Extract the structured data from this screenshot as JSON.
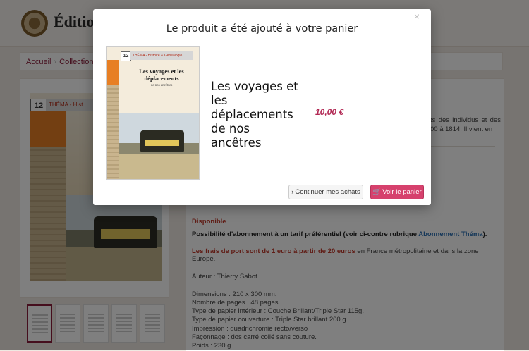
{
  "header": {
    "brand": "Éditions"
  },
  "breadcrumb": {
    "home": "Accueil",
    "collection": "Collection Thé"
  },
  "product_page": {
    "cover": {
      "number": "12",
      "series": "THÉMA - Hist"
    },
    "description_fragment": "ts des individus et des 00 à 1814. Il vient en",
    "availability": "Disponible",
    "subscription_bold": "Possibilité d'abonnement à un tarif préférentiel (voir ci-contre rubrique ",
    "subscription_link": "Abonnement Théma",
    "subscription_end": ").",
    "shipping_red": "Les frais de port sont de 1 euro à partir de 20 euros",
    "shipping_rest": " en France métropolitaine et dans la zone Europe.",
    "specs": [
      "Auteur : Thierry Sabot.",
      "",
      "Dimensions : 210 x 300 mm.",
      "Nombre de pages : 48 pages.",
      "Type de papier intérieur : Couche Brillant/Triple Star 115g.",
      "Type de papier couverture : Triple Star brillant 200 g.",
      "Impression : quadrichromie recto/verso",
      "Façonnage : dos carré collé sans couture.",
      "Poids : 230 g."
    ]
  },
  "modal": {
    "close": "×",
    "title": "Le produit a été ajouté à votre panier",
    "product_name": "Les voyages et les déplacements de nos ancêtres",
    "price": "10,00 €",
    "cover": {
      "number": "12",
      "series": "THÉMA - Histoire & Généalogie",
      "title": "Les voyages et les déplacements",
      "title_sub": "de nos ancêtres"
    },
    "continue_button": "Continuer mes achats",
    "cart_button": "Voir le panier",
    "accent_color": "#d6416d"
  }
}
